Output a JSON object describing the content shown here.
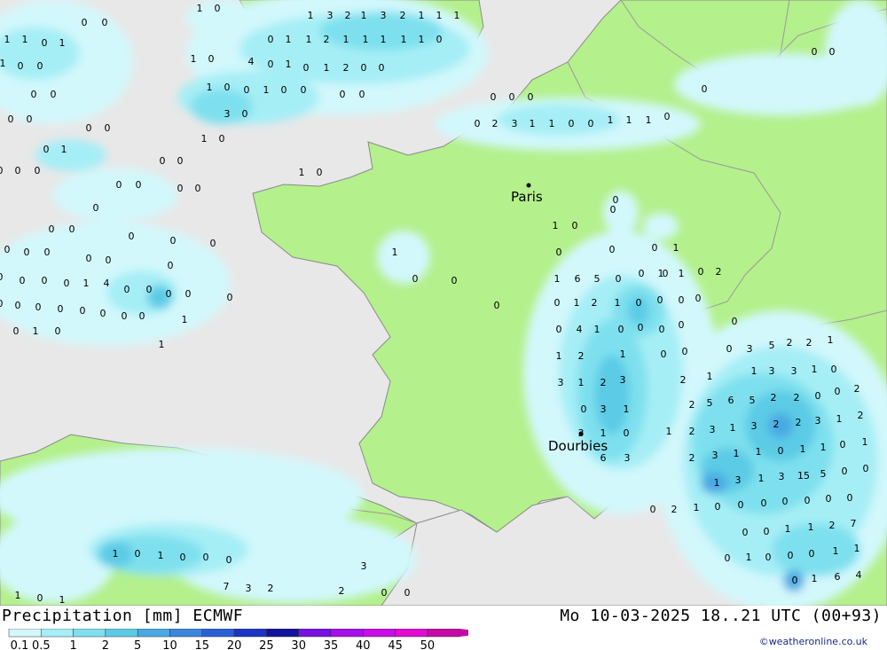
{
  "footer": {
    "title": "Precipitation [mm] ECMWF",
    "datetime": "Mo 10-03-2025 18..21 UTC (00+93)",
    "credit": "©weatheronline.co.uk"
  },
  "legend": {
    "labels": [
      "0.1",
      "0.5",
      "1",
      "2",
      "5",
      "10",
      "15",
      "20",
      "25",
      "30",
      "35",
      "40",
      "45",
      "50"
    ],
    "colors": [
      "#d2f8fc",
      "#a6eef6",
      "#7ee0ee",
      "#5ccbe6",
      "#4aa8e2",
      "#3c86dc",
      "#2c5fd6",
      "#1b35c4",
      "#12129c",
      "#7a10e0",
      "#a410e8",
      "#c80ee4",
      "#e00cd0",
      "#c40aa4"
    ]
  },
  "map": {
    "colors": {
      "sea": "#e8e8e8",
      "land": "#b4f08c",
      "border": "#9a9a9a",
      "coast": "#888888"
    },
    "cities": [
      {
        "name": "Paris"
      },
      {
        "name": "Dourbies"
      }
    ],
    "values": [
      "1",
      "0",
      "0",
      "0",
      "1",
      "3",
      "2",
      "1",
      "3",
      "2",
      "1",
      "1",
      "1",
      "1",
      "1",
      "0",
      "1",
      "0",
      "1",
      "1",
      "2",
      "1",
      "1",
      "1",
      "1",
      "1",
      "0",
      "1",
      "0",
      "0",
      "1",
      "0",
      "4",
      "0",
      "1",
      "0",
      "1",
      "2",
      "0",
      "0",
      "0",
      "0",
      "1",
      "0",
      "0",
      "1",
      "0",
      "0",
      "0",
      "0",
      "3",
      "0",
      "0",
      "0",
      "0",
      "0",
      "1",
      "0",
      "0",
      "0",
      "0",
      "0",
      "0",
      "0",
      "0",
      "2",
      "3",
      "1",
      "1",
      "0",
      "0",
      "1",
      "1",
      "1",
      "0",
      "0",
      "1",
      "0",
      "0",
      "1",
      "0",
      "0",
      "0",
      "0",
      "0",
      "0",
      "0",
      "0",
      "0",
      "0",
      "0",
      "0",
      "0",
      "0",
      "0",
      "0",
      "1",
      "0",
      "0",
      "0",
      "0",
      "0",
      "0",
      "0",
      "0",
      "0",
      "0",
      "1",
      "4",
      "0",
      "0",
      "0",
      "0",
      "0",
      "0",
      "1",
      "1",
      "0",
      "0",
      "0",
      "0",
      "0",
      "0",
      "0",
      "0",
      "0",
      "0",
      "0",
      "0",
      "0",
      "0",
      "0",
      "1",
      "0",
      "0",
      "1",
      "2",
      "1",
      "0",
      "0",
      "0",
      "0",
      "1",
      "1",
      "1",
      "0",
      "6",
      "5",
      "0",
      "0",
      "1",
      "1",
      "0",
      "2",
      "0",
      "4",
      "1",
      "0",
      "0",
      "0",
      "0",
      "0",
      "5",
      "2",
      "2",
      "1",
      "1",
      "2",
      "1",
      "0",
      "0",
      "0",
      "3",
      "3",
      "1",
      "2",
      "3",
      "2",
      "1",
      "1",
      "3",
      "3",
      "1",
      "0",
      "0",
      "3",
      "1",
      "2",
      "5",
      "6",
      "5",
      "2",
      "2",
      "0",
      "0",
      "2",
      "3",
      "1",
      "0",
      "1",
      "2",
      "3",
      "1",
      "3",
      "2",
      "2",
      "3",
      "1",
      "2",
      "6",
      "3",
      "2",
      "3",
      "1",
      "1",
      "0",
      "1",
      "1",
      "0",
      "1",
      "1",
      "3",
      "1",
      "3",
      "15",
      "5",
      "0",
      "0",
      "0",
      "2",
      "1",
      "0",
      "0",
      "0",
      "0",
      "0",
      "0",
      "0",
      "0",
      "0",
      "1",
      "1",
      "2",
      "7",
      "1",
      "0",
      "1",
      "0",
      "0",
      "0",
      "0",
      "1",
      "0",
      "0",
      "0",
      "1",
      "1",
      "1",
      "0",
      "1",
      "7",
      "3",
      "2",
      "2",
      "3",
      "0",
      "0",
      "0",
      "1",
      "6",
      "4",
      "3",
      "1",
      "2",
      "3",
      "2",
      "0",
      "0",
      "1",
      "1",
      "0",
      "0",
      "2",
      "0",
      "8",
      "0",
      "0",
      "0"
    ]
  }
}
